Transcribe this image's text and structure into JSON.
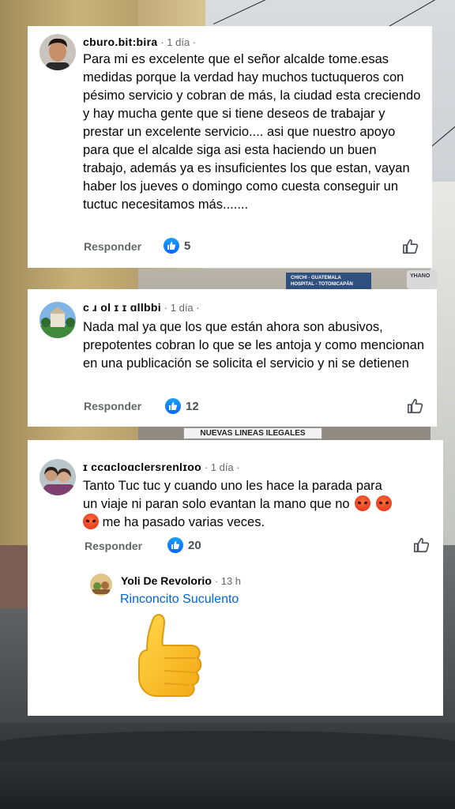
{
  "comments": [
    {
      "author": "ᴄburo.bit:bira",
      "time": "1 día",
      "text": "Para mi es excelente que el señor alcalde tome.esas medidas porque la verdad hay muchos tuctuqueros con pésimo servicio y cobran de más, la ciudad esta creciendo y hay mucha gente que si tiene deseos de trabajar y prestar un excelente servicio.... asi que nuestro apoyo para que el alcalde siga asi esta haciendo un buen trabajo, además ya es insuficientes los que estan, vayan haber los jueves o domingo como cuesta conseguir un tuctuc necesitamos más.......",
      "reply_label": "Responder",
      "like_count": "5"
    },
    {
      "author": "ᴄ    ɹ  ol ɪ ɪ ɑllbbi",
      "time": "1 día",
      "text": "Nada mal ya que los que están ahora son abusivos, prepotentes cobran lo que se les antoja y como mencionan en una publicación se solicita el servicio y ni se detienen",
      "reply_label": "Responder",
      "like_count": "12"
    },
    {
      "author": "ɪ ccɑcloɑclersrenlɪoo",
      "time": "1 día",
      "text_line1": "Tanto Tuc tuc y cuando uno les hace la parada para",
      "text_line2": "un viaje ni paran solo evantan la mano que no",
      "text_line3": "me ha pasado varias veces.",
      "reply_label": "Responder",
      "like_count": "20"
    }
  ],
  "reply": {
    "author": "Yoli De Revolorio",
    "time": "13 h",
    "link_text": "Rinconcito Suculento"
  },
  "background": {
    "sign_top": "CHICHI - GUATEMALA",
    "sign_bottom": "HOSPITAL - TOTONICAPÁN",
    "sign_right": "YHANO",
    "banner": "NUEVAS LINEAS ILEGALES"
  },
  "colors": {
    "like_blue": "#0866ff",
    "link_blue": "#0064d1",
    "meta_gray": "#65676b"
  },
  "icons": [
    "like-badge-icon",
    "like-outline-icon",
    "angry-emoji-icon",
    "thumbs-up-sticker-icon"
  ]
}
